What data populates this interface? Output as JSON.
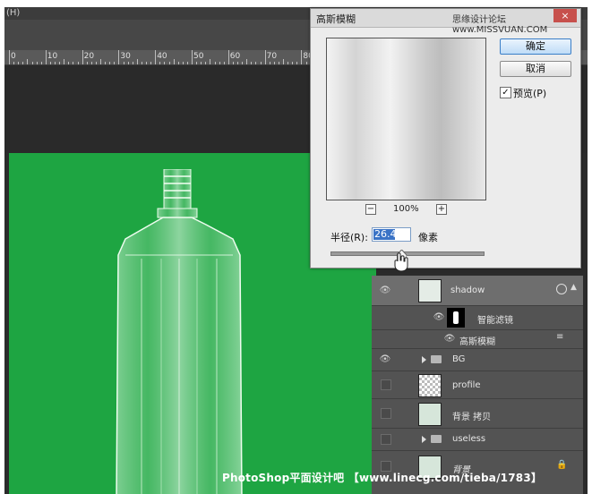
{
  "menubar": {
    "fragment": "(H)"
  },
  "ruler": {
    "ticks": [
      "0",
      "10",
      "20",
      "30",
      "40",
      "50",
      "60",
      "70",
      "80"
    ]
  },
  "dialog": {
    "title": "高斯模糊",
    "watermark": "思缘设计论坛 www.MISSVUAN.COM",
    "close_label": "×",
    "zoom_minus": "−",
    "zoom_level": "100%",
    "zoom_plus": "+",
    "ok_label": "确定",
    "cancel_label": "取消",
    "preview_label": "预览(P)",
    "preview_checked": "✓",
    "radius_label": "半径(R):",
    "radius_value": "26.4",
    "radius_unit": "像素"
  },
  "layers": {
    "items": [
      {
        "name": "shadow"
      },
      {
        "name": "智能滤镜"
      },
      {
        "name": "高斯模糊"
      },
      {
        "name": "BG"
      },
      {
        "name": "profile"
      },
      {
        "name": "背景 拷贝"
      },
      {
        "name": "useless"
      },
      {
        "name": "背景"
      }
    ]
  },
  "footer": {
    "watermark": "PhotoShop平面设计吧 【www.linecg.com/tieba/1783】"
  },
  "colors": {
    "canvas": "#1ea542",
    "selection": "#3a73c6",
    "panel": "#535353"
  }
}
